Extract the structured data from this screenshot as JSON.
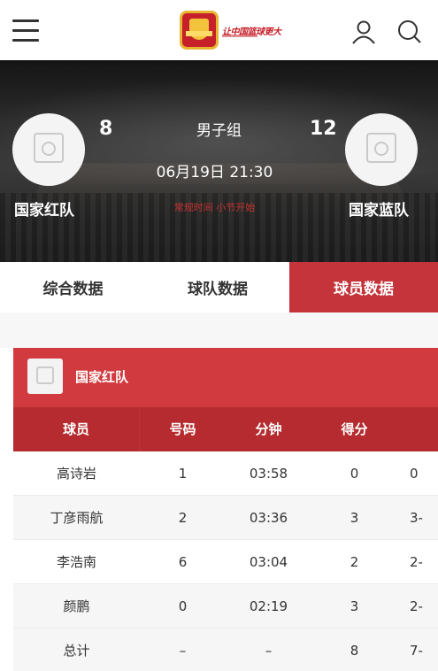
{
  "header": {
    "menu_icon": "hamburger-menu-icon",
    "logo_icon": "basketball-association-logo",
    "slogan": "让中国篮球更大",
    "user_icon": "user-icon",
    "search_icon": "search-icon"
  },
  "game": {
    "group": "男子组",
    "datetime": "06月19日 21:30",
    "status": "常规时间 小节开始",
    "home": {
      "name": "国家红队",
      "score": "8"
    },
    "away": {
      "name": "国家蓝队",
      "score": "12"
    }
  },
  "tabs": [
    {
      "label": "综合数据",
      "active": false
    },
    {
      "label": "球队数据",
      "active": false
    },
    {
      "label": "球员数据",
      "active": true
    }
  ],
  "stats": {
    "team": "国家红队",
    "columns": [
      "球员",
      "号码",
      "分钟",
      "得分",
      ""
    ],
    "rows": [
      {
        "player": "高诗岩",
        "number": "1",
        "minutes": "03:58",
        "points": "0",
        "extra": "0"
      },
      {
        "player": "丁彦雨航",
        "number": "2",
        "minutes": "03:36",
        "points": "3",
        "extra": "3-"
      },
      {
        "player": "李浩南",
        "number": "6",
        "minutes": "03:04",
        "points": "2",
        "extra": "2-"
      },
      {
        "player": "颜鹏",
        "number": "0",
        "minutes": "02:19",
        "points": "3",
        "extra": "2-"
      }
    ],
    "total": {
      "player": "总计",
      "number": "–",
      "minutes": "–",
      "points": "8",
      "extra": "7-"
    }
  },
  "colors": {
    "accent": "#c4343a",
    "table_header": "#b52b2f"
  }
}
